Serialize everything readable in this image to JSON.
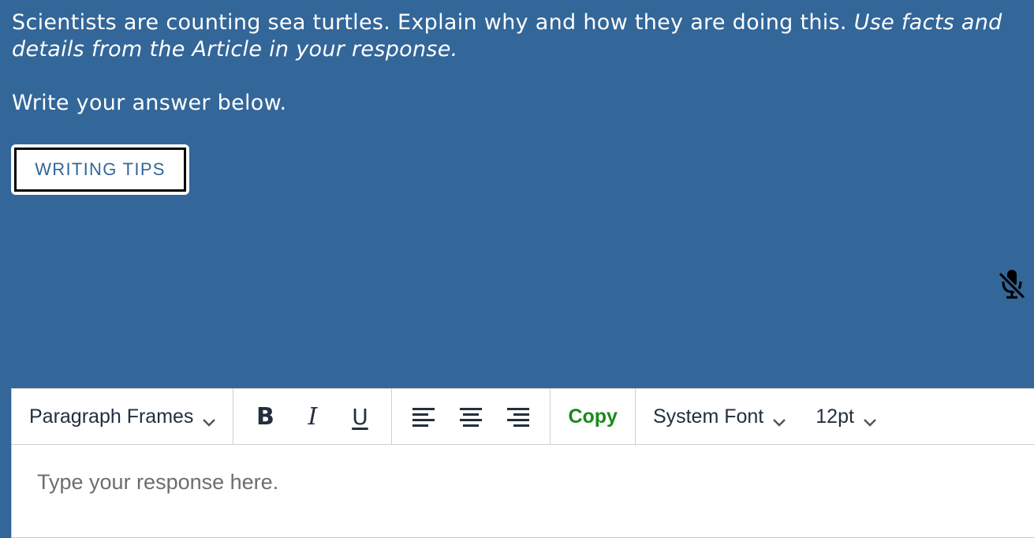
{
  "prompt": {
    "question": "Scientists are counting sea turtles. Explain why and how they are doing this.",
    "emphasis": "Use facts and details from the Article in your response."
  },
  "instruction": "Write your answer below.",
  "writing_tips_button": "WRITING TIPS",
  "mic": {
    "icon": "microphone-off-icon"
  },
  "editor": {
    "toolbar": {
      "paragraph_select": "Paragraph Frames",
      "bold_icon": "bold-icon",
      "italic_icon": "italic-icon",
      "underline_icon": "underline-icon",
      "align_left_icon": "align-left-icon",
      "align_center_icon": "align-center-icon",
      "align_right_icon": "align-right-icon",
      "copy_label": "Copy",
      "font_select": "System Font",
      "size_select": "12pt"
    },
    "placeholder": "Type your response here."
  },
  "colors": {
    "background": "#336699",
    "copy_green": "#1a8a1a",
    "toolbar_text": "#222f3e"
  }
}
